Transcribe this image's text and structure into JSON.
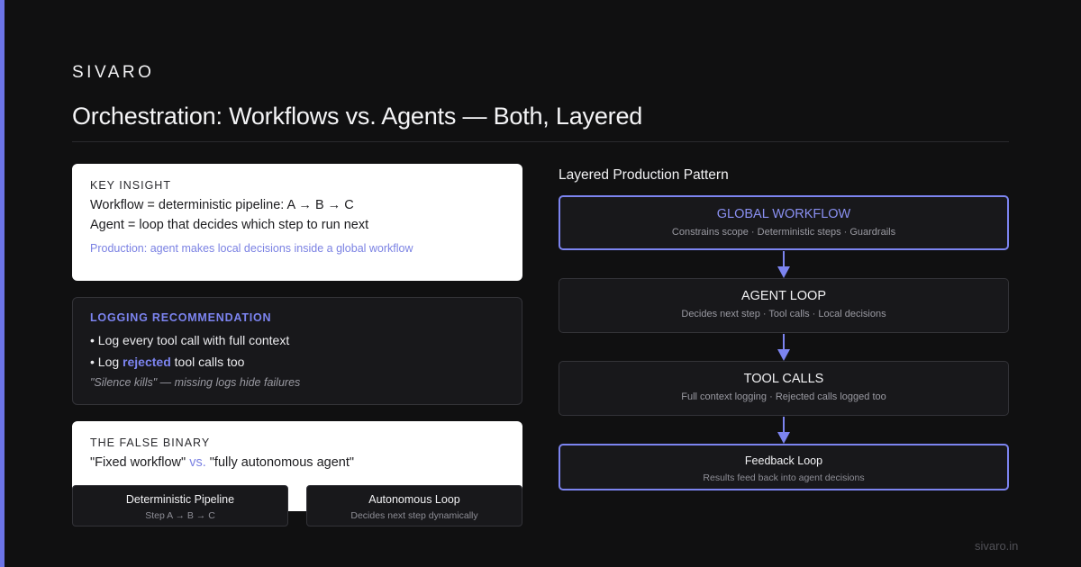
{
  "brand": "SIVARO",
  "title": "Orchestration: Workflows vs. Agents — Both, Layered",
  "key_insight": {
    "kicker": "KEY INSIGHT",
    "line1": "Workflow = deterministic pipeline: A → B → C",
    "line2": "Agent = loop that decides which step to run next",
    "note": "Production: agent makes local decisions inside a global workflow"
  },
  "logging": {
    "kicker": "LOGGING RECOMMENDATION",
    "bullet1": "• Log every tool call with full context",
    "bullet2_prefix": "• Log ",
    "bullet2_highlight": "rejected",
    "bullet2_suffix": " tool calls too",
    "quote": "\"Silence kills\" — missing logs hide failures"
  },
  "false_binary": {
    "kicker": "THE FALSE BINARY",
    "left": "\"Fixed workflow\" ",
    "vs": "vs.",
    "right": " \"fully autonomous agent\""
  },
  "mini_cards": [
    {
      "title": "Deterministic Pipeline",
      "sub": "Step A → B → C"
    },
    {
      "title": "Autonomous Loop",
      "sub": "Decides next step dynamically"
    }
  ],
  "pattern": {
    "title": "Layered Production Pattern",
    "layers": [
      {
        "title": "GLOBAL WORKFLOW",
        "sub": "Constrains scope · Deterministic steps · Guardrails"
      },
      {
        "title": "AGENT LOOP",
        "sub": "Decides next step · Tool calls · Local decisions"
      },
      {
        "title": "TOOL CALLS",
        "sub": "Full context logging · Rejected calls logged too"
      },
      {
        "title": "Feedback Loop",
        "sub": "Results feed back into agent decisions"
      }
    ]
  },
  "site": "sivaro.in",
  "colors": {
    "accent": "#7c84f0",
    "background": "#101011",
    "card_dark": "#18181b"
  }
}
